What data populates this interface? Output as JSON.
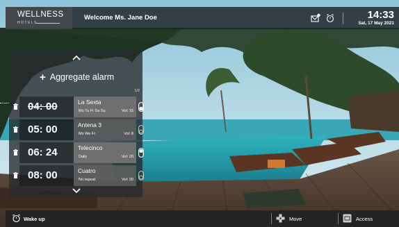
{
  "header": {
    "logo_line1": "WELLNESS",
    "logo_line2": "HOTELS",
    "welcome": "Welcome Ms. Jane Doe",
    "time": "14:33",
    "date": "Sat, 17 May 2021",
    "icons": [
      "message-icon",
      "alarm-clock-icon"
    ]
  },
  "panel": {
    "aggregate_label": "Aggregate alarm",
    "pager": "1/2",
    "alarms": [
      {
        "time": "04: 00",
        "station": "La Sexta",
        "days": "Mo Tu Fr Sa Su",
        "volume": "Vol: 15",
        "enabled": true,
        "struck": true
      },
      {
        "time": "05: 00",
        "station": "Antena 3",
        "days": "Mo We Fr",
        "volume": "Vol: 8",
        "enabled": false,
        "struck": false
      },
      {
        "time": "06: 24",
        "station": "Telecinco",
        "days": "Daily",
        "volume": "Vol: 20",
        "enabled": true,
        "struck": false
      },
      {
        "time": "08: 00",
        "station": "Cuatro",
        "days": "No repeat",
        "volume": "Vol: 20",
        "enabled": false,
        "struck": false
      }
    ]
  },
  "footer": {
    "wake_up": "Wake up",
    "move": "Move",
    "access": "Access"
  },
  "colors": {
    "bar_bg": "#1e2024",
    "row_active": "#6f6f6f",
    "sea": "#2fa6b3",
    "sky": "#b9dbe6"
  }
}
